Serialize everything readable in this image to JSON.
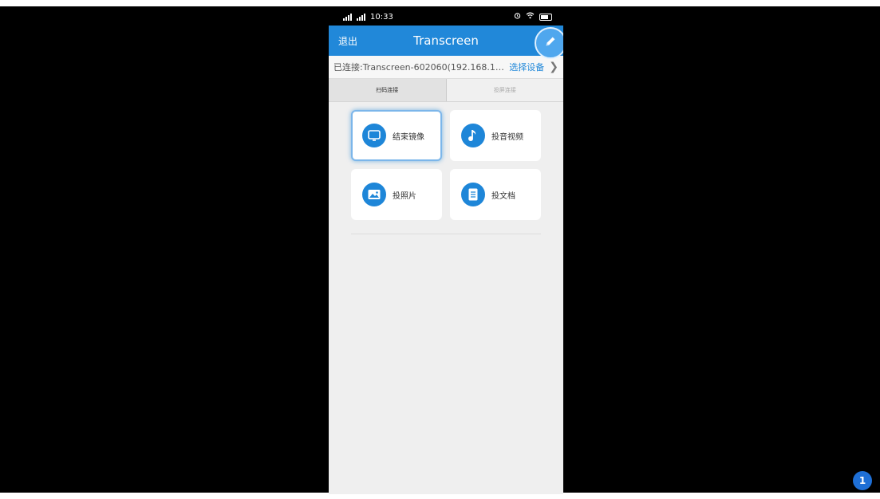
{
  "status_bar": {
    "time": "10:33"
  },
  "app_bar": {
    "exit_label": "退出",
    "title": "Transcreen"
  },
  "connection": {
    "text": "已连接:Transcreen-602060(192.168.13···",
    "select_device_label": "选择设备"
  },
  "tabs": [
    {
      "label": "扫码连接",
      "active": true
    },
    {
      "label": "投屏连接",
      "active": false
    }
  ],
  "actions": [
    {
      "label": "结束镜像",
      "icon": "monitor-icon",
      "active": true
    },
    {
      "label": "投音视频",
      "icon": "music-note-icon",
      "active": false
    },
    {
      "label": "投照片",
      "icon": "image-icon",
      "active": false
    },
    {
      "label": "投文档",
      "icon": "document-icon",
      "active": false
    }
  ],
  "notification": {
    "count": "1"
  },
  "colors": {
    "primary": "#2188d9",
    "background": "#000000",
    "panel": "#efefef"
  }
}
